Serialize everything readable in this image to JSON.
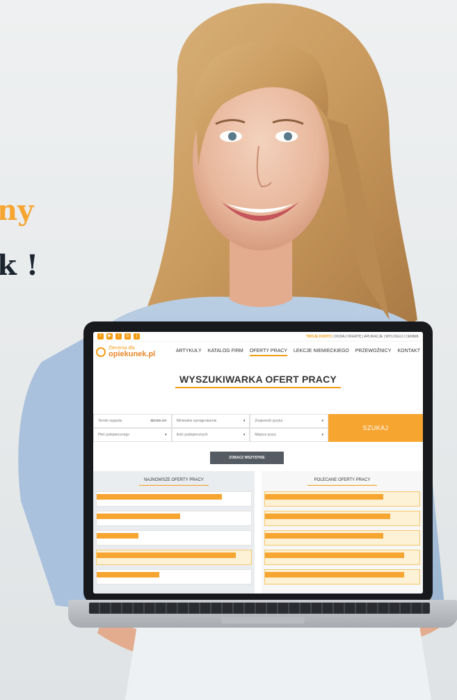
{
  "headline": {
    "line1": "ny",
    "line2": "k !"
  },
  "site": {
    "account_prefix": "TWOJE KONTO",
    "account_links": "| DODAJ OFERTĘ | APLIKACJE | WYLOGUJ | CENNIK",
    "logo_line1": "Zlecenia dla",
    "logo_line2": "opiekunek.pl",
    "nav": [
      "ARTYKUŁY",
      "KATALOG FIRM",
      "OFERTY PRACY",
      "LEKCJE NIEMIECKIEGO",
      "PRZEWOŹNICY",
      "KONTAKT"
    ],
    "nav_active_index": 2,
    "page_title": "WYSZUKIWARKA OFERT PRACY",
    "fields": [
      {
        "label": "Termin wyjazdu",
        "hint": "dd.mm.rrrr"
      },
      {
        "label": "Minimalne wynagrodzenie",
        "hint": "▾"
      },
      {
        "label": "Znajomość języka",
        "hint": "▾"
      },
      {
        "label": "Płeć podopiecznego",
        "hint": "▾"
      },
      {
        "label": "Ilość podopiecznych",
        "hint": "▾"
      },
      {
        "label": "Miejsce pracy",
        "hint": "▾"
      }
    ],
    "search_button": "SZUKAJ",
    "see_all_button": "ZOBACZ WSZYSTKIE",
    "left_column_title": "NAJNOWSZE OFERTY PRACY",
    "right_column_title": "POLECANE OFERTY PRACY"
  },
  "colors": {
    "accent": "#f6a531",
    "dark": "#17191c"
  }
}
